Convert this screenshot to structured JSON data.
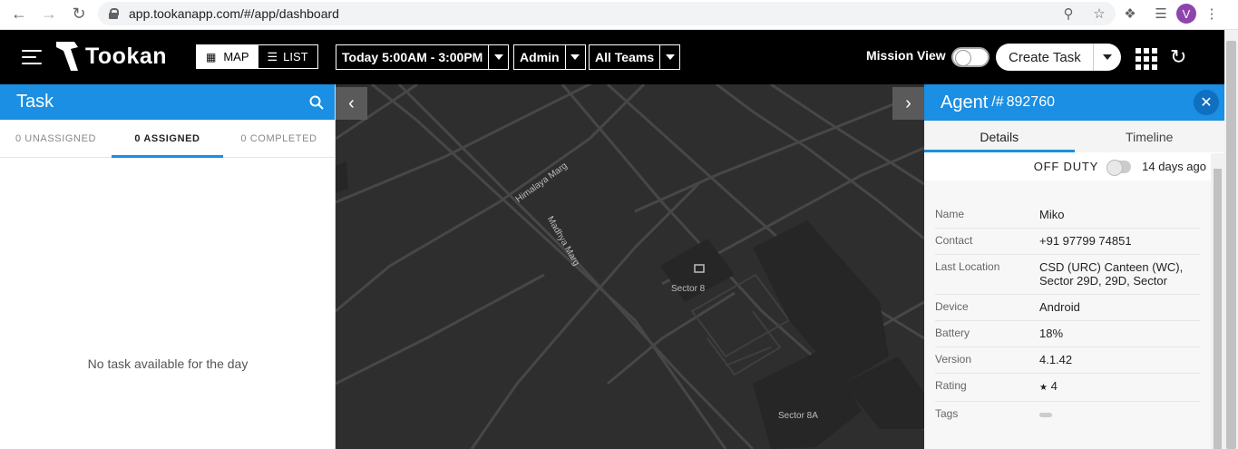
{
  "browser": {
    "url": "app.tookanapp.com/#/app/dashboard",
    "profile_initial": "V"
  },
  "header": {
    "brand": "Tookan",
    "view_map": "MAP",
    "view_list": "LIST",
    "date_filter": "Today 5:00AM - 3:00PM",
    "role_filter": "Admin",
    "team_filter": "All Teams",
    "mission_view": "Mission View",
    "create_task": "Create Task"
  },
  "task_panel": {
    "title": "Task",
    "tabs": [
      "0 UNASSIGNED",
      "0 ASSIGNED",
      "0 COMPLETED"
    ],
    "active_tab": 1,
    "empty_message": "No task available for the day"
  },
  "map": {
    "labels": {
      "road1": "Himalaya Marg",
      "road2": "Madhya Marg",
      "area1": "Sector 8",
      "area2": "Sector 8A"
    }
  },
  "agent_panel": {
    "title": "Agent",
    "id_prefix": "/#",
    "id": "892760",
    "tabs": [
      "Details",
      "Timeline"
    ],
    "active_tab": 0,
    "duty_status": "OFF DUTY",
    "last_seen": "14 days ago",
    "details": [
      {
        "label": "Name",
        "value": "Miko"
      },
      {
        "label": "Contact",
        "value": "+91 97799 74851"
      },
      {
        "label": "Last Location",
        "value": "CSD (URC) Canteen (WC), Sector 29D, 29D, Sector"
      },
      {
        "label": "Device",
        "value": "Android"
      },
      {
        "label": "Battery",
        "value": "18%"
      },
      {
        "label": "Version",
        "value": "4.1.42"
      },
      {
        "label": "Rating",
        "value": "4"
      },
      {
        "label": "Tags",
        "value": ""
      }
    ]
  },
  "colors": {
    "accent": "#1a8fe3",
    "appbar": "#000000",
    "map_bg": "#2e2e2e"
  }
}
